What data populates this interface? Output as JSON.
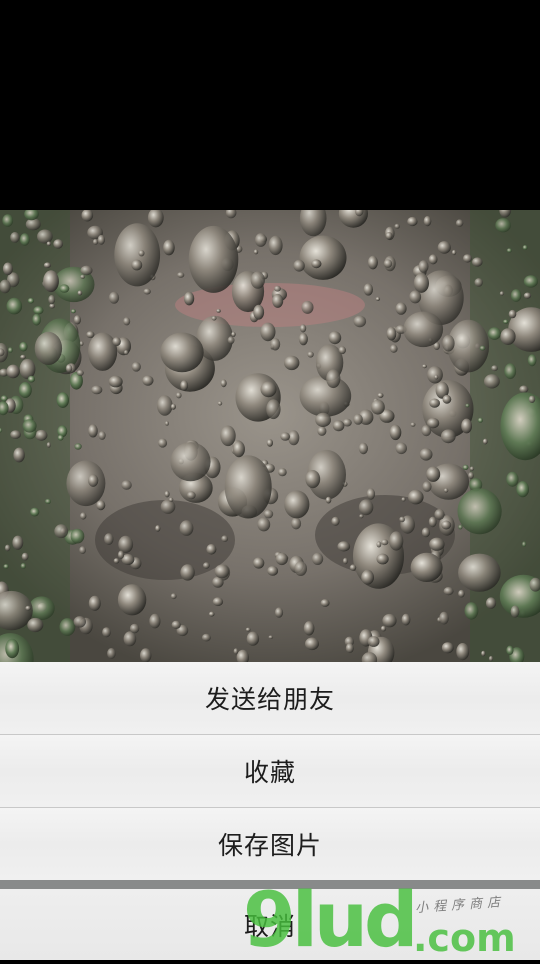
{
  "photo": {
    "icon": "photo-preview"
  },
  "action_sheet": {
    "items": [
      {
        "label": "发送给朋友"
      },
      {
        "label": "收藏"
      },
      {
        "label": "保存图片"
      }
    ],
    "cancel_label": "取消"
  },
  "watermark": {
    "brand": "9lud",
    "domain": ".com",
    "tagline": "小程序商店"
  },
  "colors": {
    "sheet_bg": "#f0f0f0",
    "separator": "#c8c8c8",
    "text": "#1d1d1d",
    "watermark_green": "#46be3c"
  }
}
